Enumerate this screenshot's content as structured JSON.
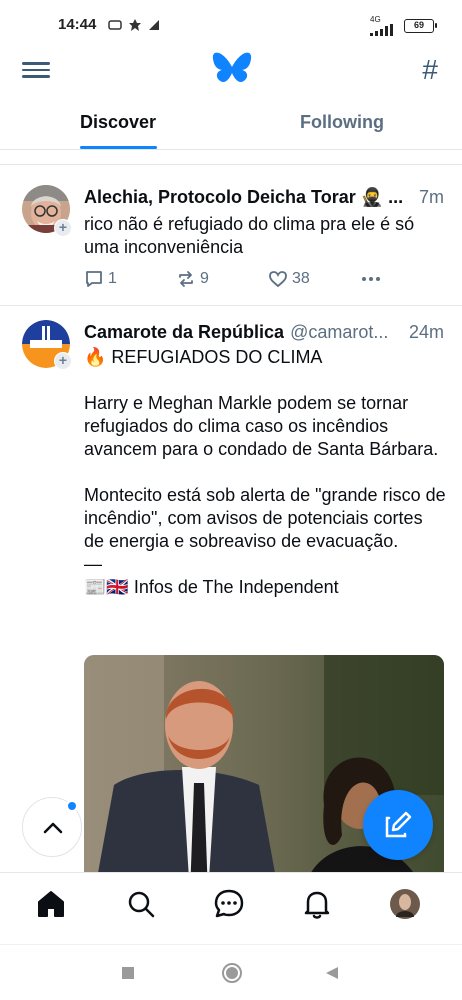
{
  "status_bar": {
    "time": "14:44",
    "battery": "69",
    "network": "4G"
  },
  "tabs": {
    "discover": "Discover",
    "following": "Following"
  },
  "posts": [
    {
      "name": "Alechia, Protocolo Deicha Torar 🥷 ...",
      "time": "7m",
      "text": "rico não é refugiado do clima pra ele é só uma inconveniência",
      "replies": "1",
      "reposts": "9",
      "likes": "38"
    },
    {
      "name": "Camarote da República",
      "handle": "@camarot...",
      "time": "24m",
      "text": "🔥 REFUGIADOS DO CLIMA\n\nHarry e Meghan Markle podem se tornar refugiados do clima caso os incêndios avancem para o condado de Santa Bárbara.\n\nMontecito está sob alerta de \"grande risco de incêndio\", com avisos de potenciais cortes de energia e sobreaviso de evacuação.\n—\n📰🇬🇧 Infos de The Independent"
    }
  ],
  "colors": {
    "accent": "#1083fe",
    "muted": "#5c6f82",
    "nav": "#3b5a78"
  },
  "icons": [
    "menu-icon",
    "butterfly-logo",
    "hash-icon",
    "reply-icon",
    "repost-icon",
    "like-icon",
    "more-icon",
    "chevron-up-icon",
    "compose-icon",
    "home-icon",
    "search-icon",
    "chat-icon",
    "bell-icon"
  ]
}
